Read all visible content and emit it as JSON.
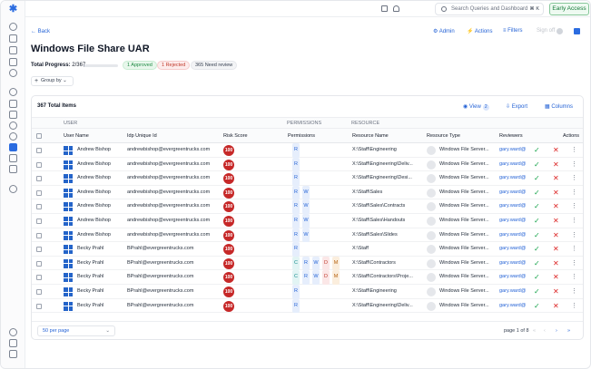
{
  "topbar": {
    "search_placeholder": "Search Queries and Dashboard",
    "search_shortcut": "⌘ K",
    "early_access": "Early Access"
  },
  "page": {
    "back": "Back",
    "title": "Windows File Share UAR",
    "admin": "Admin",
    "actions": "Actions",
    "filters": "Filters",
    "sign_off": "Sign off",
    "total_progress_label": "Total Progress:",
    "total_progress_value": "2/367",
    "progress_fraction": 0.005,
    "chips": {
      "approved": "1 Approved",
      "rejected": "1 Rejected",
      "need_review": "365 Need review"
    },
    "group_by": "Group by"
  },
  "table": {
    "total_items": "367 Total Items",
    "view_label": "View",
    "view_count": "2",
    "export": "Export",
    "columns": "Columns",
    "groups": {
      "user": "USER",
      "permissions": "PERMISSIONS",
      "resource": "RESOURCE"
    },
    "headers": {
      "user_name": "User Name",
      "idp_id": "Idp Unique Id",
      "risk": "Risk Score",
      "permissions": "Permissions",
      "resource_name": "Resource Name",
      "resource_type": "Resource Type",
      "reviewers": "Reviewers",
      "actions": "Actions"
    },
    "rows": [
      {
        "user": "Andrew Bishop",
        "id": "andrewbishop@evergreentrucks.com",
        "risk": "100",
        "perms": [
          "R"
        ],
        "resource": "X:\\Staff\\Engineering",
        "type": "Windows File Server...",
        "reviewer": "gary.ward@"
      },
      {
        "user": "Andrew Bishop",
        "id": "andrewbishop@evergreentrucks.com",
        "risk": "100",
        "perms": [
          "R"
        ],
        "resource": "X:\\Staff\\Engineering\\Deliv...",
        "type": "Windows File Server...",
        "reviewer": "gary.ward@"
      },
      {
        "user": "Andrew Bishop",
        "id": "andrewbishop@evergreentrucks.com",
        "risk": "100",
        "perms": [
          "R"
        ],
        "resource": "X:\\Staff\\Engineering\\Desi...",
        "type": "Windows File Server...",
        "reviewer": "gary.ward@"
      },
      {
        "user": "Andrew Bishop",
        "id": "andrewbishop@evergreentrucks.com",
        "risk": "100",
        "perms": [
          "R",
          "W"
        ],
        "resource": "X:\\Staff\\Sales",
        "type": "Windows File Server...",
        "reviewer": "gary.ward@"
      },
      {
        "user": "Andrew Bishop",
        "id": "andrewbishop@evergreentrucks.com",
        "risk": "100",
        "perms": [
          "R",
          "W"
        ],
        "resource": "X:\\Staff\\Sales\\Contracts",
        "type": "Windows File Server...",
        "reviewer": "gary.ward@"
      },
      {
        "user": "Andrew Bishop",
        "id": "andrewbishop@evergreentrucks.com",
        "risk": "100",
        "perms": [
          "R",
          "W"
        ],
        "resource": "X:\\Staff\\Sales\\Handouts",
        "type": "Windows File Server...",
        "reviewer": "gary.ward@"
      },
      {
        "user": "Andrew Bishop",
        "id": "andrewbishop@evergreentrucks.com",
        "risk": "100",
        "perms": [
          "R",
          "W"
        ],
        "resource": "X:\\Staff\\Sales\\Slides",
        "type": "Windows File Server...",
        "reviewer": "gary.ward@"
      },
      {
        "user": "Becky Prahl",
        "id": "BPrahl@evergreentrucks.com",
        "risk": "100",
        "perms": [
          "R"
        ],
        "resource": "X:\\Staff",
        "type": "Windows File Server...",
        "reviewer": "gary.ward@"
      },
      {
        "user": "Becky Prahl",
        "id": "BPrahl@evergreentrucks.com",
        "risk": "100",
        "perms": [
          "C",
          "R",
          "W",
          "D",
          "M"
        ],
        "resource": "X:\\Staff\\Contractors",
        "type": "Windows File Server...",
        "reviewer": "gary.ward@"
      },
      {
        "user": "Becky Prahl",
        "id": "BPrahl@evergreentrucks.com",
        "risk": "100",
        "perms": [
          "C",
          "R",
          "W",
          "D",
          "M"
        ],
        "resource": "X:\\Staff\\Contractors\\Proje...",
        "type": "Windows File Server...",
        "reviewer": "gary.ward@"
      },
      {
        "user": "Becky Prahl",
        "id": "BPrahl@evergreentrucks.com",
        "risk": "100",
        "perms": [
          "R"
        ],
        "resource": "X:\\Staff\\Engineering",
        "type": "Windows File Server...",
        "reviewer": "gary.ward@"
      },
      {
        "user": "Becky Prahl",
        "id": "BPrahl@evergreentrucks.com",
        "risk": "100",
        "perms": [
          "R"
        ],
        "resource": "X:\\Staff\\Engineering\\Deliv...",
        "type": "Windows File Server...",
        "reviewer": "gary.ward@"
      }
    ],
    "footer": {
      "per_page": "50 per page",
      "page_info": "page 1 of 8",
      "first": "«",
      "prev": "‹",
      "next": "›",
      "last": "»"
    }
  },
  "colors": {
    "accent": "#2563d6",
    "risk": "#c62828",
    "approve": "#16a34a",
    "reject": "#dc2626"
  }
}
